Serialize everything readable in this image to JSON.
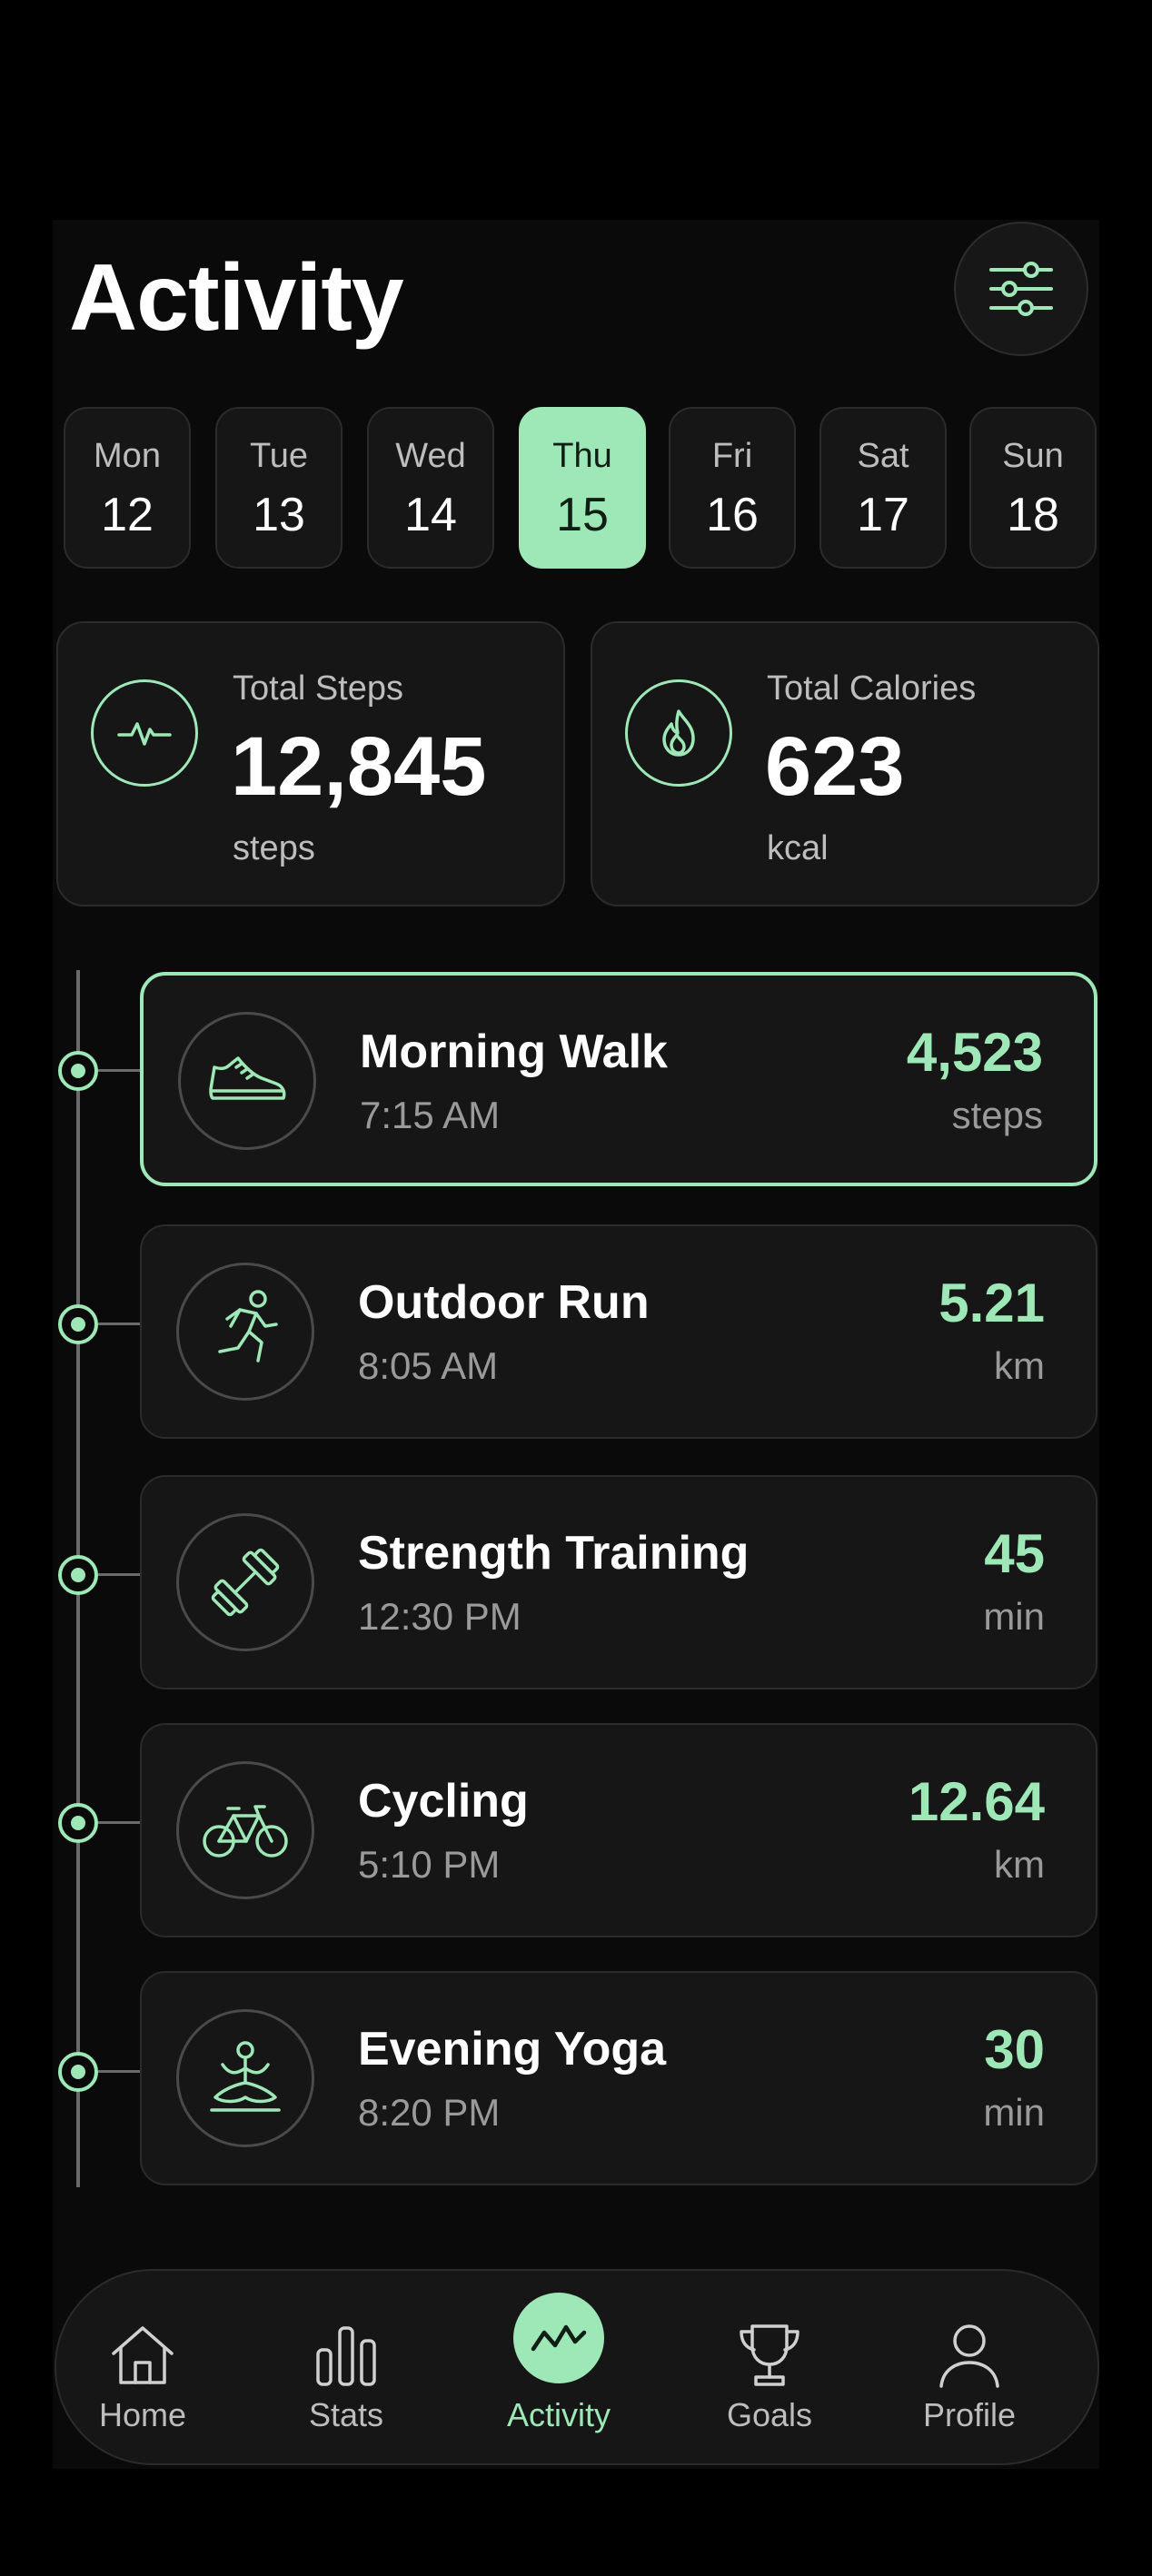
{
  "header": {
    "title": "Activity",
    "filter_icon": "sliders-icon"
  },
  "days": [
    {
      "name": "Mon",
      "num": "12",
      "selected": false
    },
    {
      "name": "Tue",
      "num": "13",
      "selected": false
    },
    {
      "name": "Wed",
      "num": "14",
      "selected": false
    },
    {
      "name": "Thu",
      "num": "15",
      "selected": true
    },
    {
      "name": "Fri",
      "num": "16",
      "selected": false
    },
    {
      "name": "Sat",
      "num": "17",
      "selected": false
    },
    {
      "name": "Sun",
      "num": "18",
      "selected": false
    }
  ],
  "summary": {
    "steps": {
      "label": "Total Steps",
      "value": "12,845",
      "unit": "steps",
      "icon": "pulse-icon"
    },
    "calories": {
      "label": "Total Calories",
      "value": "623",
      "unit": "kcal",
      "icon": "flame-icon"
    }
  },
  "activities": [
    {
      "name": "Morning Walk",
      "time": "7:15 AM",
      "value": "4,523",
      "unit": "steps",
      "icon": "shoe-icon",
      "highlighted": true
    },
    {
      "name": "Outdoor Run",
      "time": "8:05 AM",
      "value": "5.21",
      "unit": "km",
      "icon": "runner-icon",
      "highlighted": false
    },
    {
      "name": "Strength Training",
      "time": "12:30 PM",
      "value": "45",
      "unit": "min",
      "icon": "dumbbell-icon",
      "highlighted": false
    },
    {
      "name": "Cycling",
      "time": "5:10 PM",
      "value": "12.64",
      "unit": "km",
      "icon": "bicycle-icon",
      "highlighted": false
    },
    {
      "name": "Evening Yoga",
      "time": "8:20 PM",
      "value": "30",
      "unit": "min",
      "icon": "yoga-icon",
      "highlighted": false
    }
  ],
  "nav": [
    {
      "label": "Home",
      "icon": "home-icon",
      "active": false
    },
    {
      "label": "Stats",
      "icon": "bar-chart-icon",
      "active": false
    },
    {
      "label": "Activity",
      "icon": "activity-wave-icon",
      "active": true
    },
    {
      "label": "Goals",
      "icon": "trophy-icon",
      "active": false
    },
    {
      "label": "Profile",
      "icon": "user-icon",
      "active": false
    }
  ],
  "colors": {
    "accent": "#9de8b6",
    "background": "#0a0a0a",
    "card": "#161616",
    "text_muted": "#9a9a9a"
  }
}
